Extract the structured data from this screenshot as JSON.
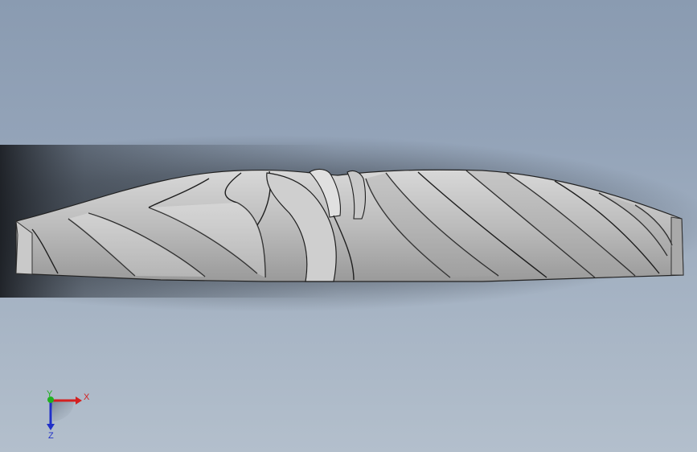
{
  "viewport": {
    "background_top": "#8a9bb1",
    "background_bottom": "#b3bfcc",
    "model": "impeller-side-view"
  },
  "triad": {
    "x_label": "X",
    "y_label": "Y",
    "z_label": "Z",
    "x_color": "#d42020",
    "y_color": "#20b020",
    "z_color": "#2030c8"
  }
}
